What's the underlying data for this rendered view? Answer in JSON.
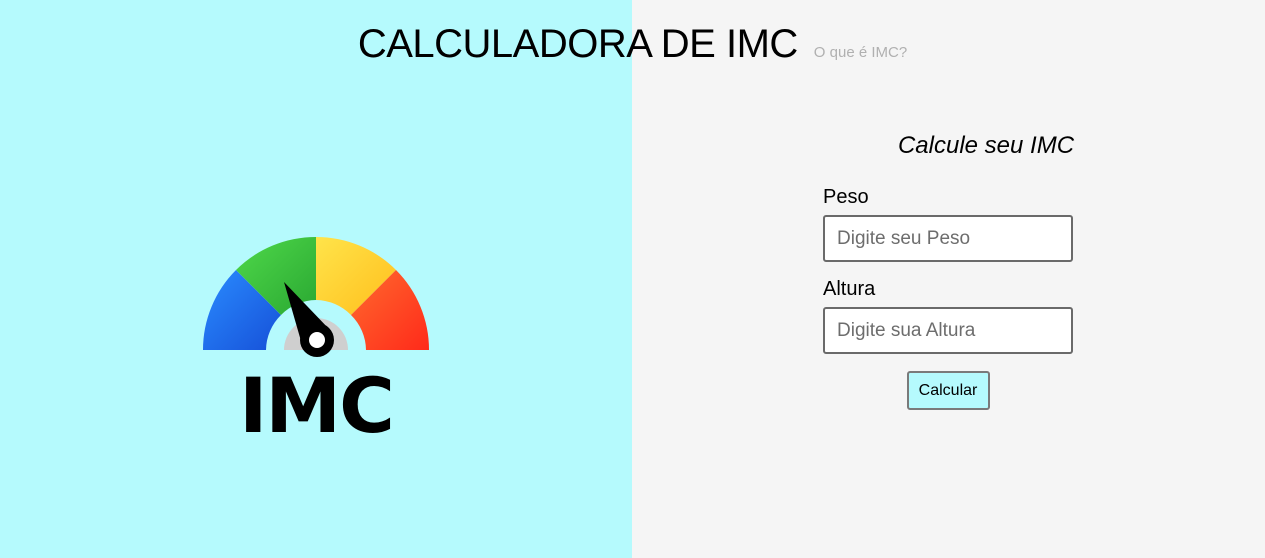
{
  "header": {
    "title": "CALCULADORA DE IMC",
    "help_link": "O que é IMC?"
  },
  "logo": {
    "text": "IMC",
    "gauge_colors": [
      "#1f6ff0",
      "#3cc23c",
      "#ffd42e",
      "#ff3d22"
    ]
  },
  "form": {
    "heading": "Calcule seu IMC",
    "weight_label": "Peso",
    "weight_placeholder": "Digite seu Peso",
    "height_label": "Altura",
    "height_placeholder": "Digite sua Altura",
    "submit_label": "Calcular"
  },
  "colors": {
    "left_bg": "#b5fafd",
    "right_bg": "#f5f5f5"
  }
}
